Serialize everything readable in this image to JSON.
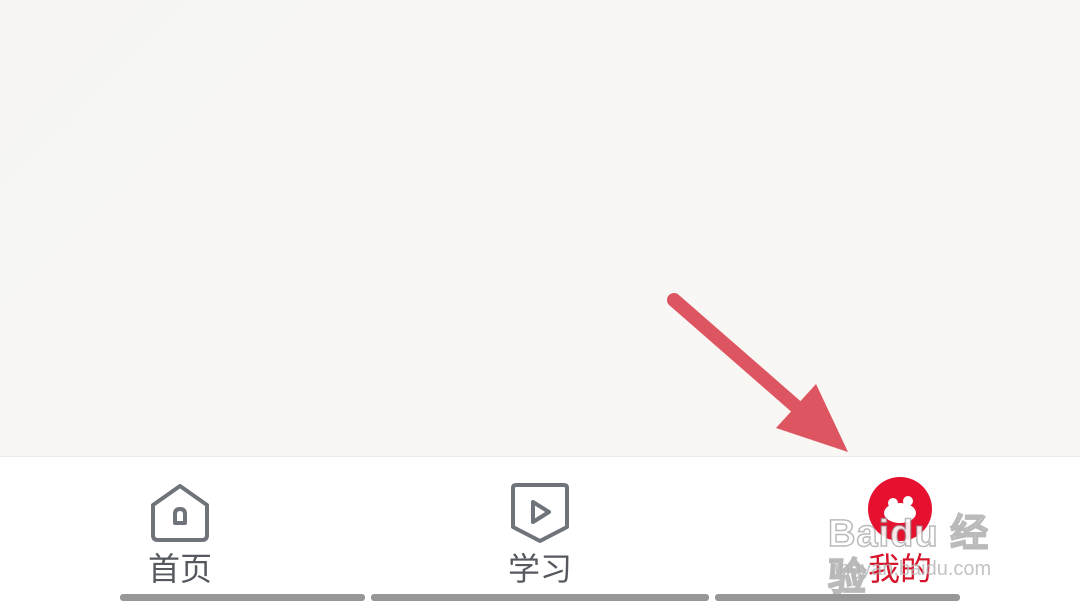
{
  "tabbar": {
    "tabs": [
      {
        "label": "首页",
        "icon": "home-icon",
        "active": false
      },
      {
        "label": "学习",
        "icon": "play-icon",
        "active": false
      },
      {
        "label": "我的",
        "icon": "profile-mascot-icon",
        "active": true
      }
    ]
  },
  "watermark": {
    "brand": "Baidu 经验",
    "sub": "jingyan.baidu.com"
  },
  "colors": {
    "active": "#d6152d",
    "inactive": "#55595f",
    "arrow": "#dd5560"
  }
}
